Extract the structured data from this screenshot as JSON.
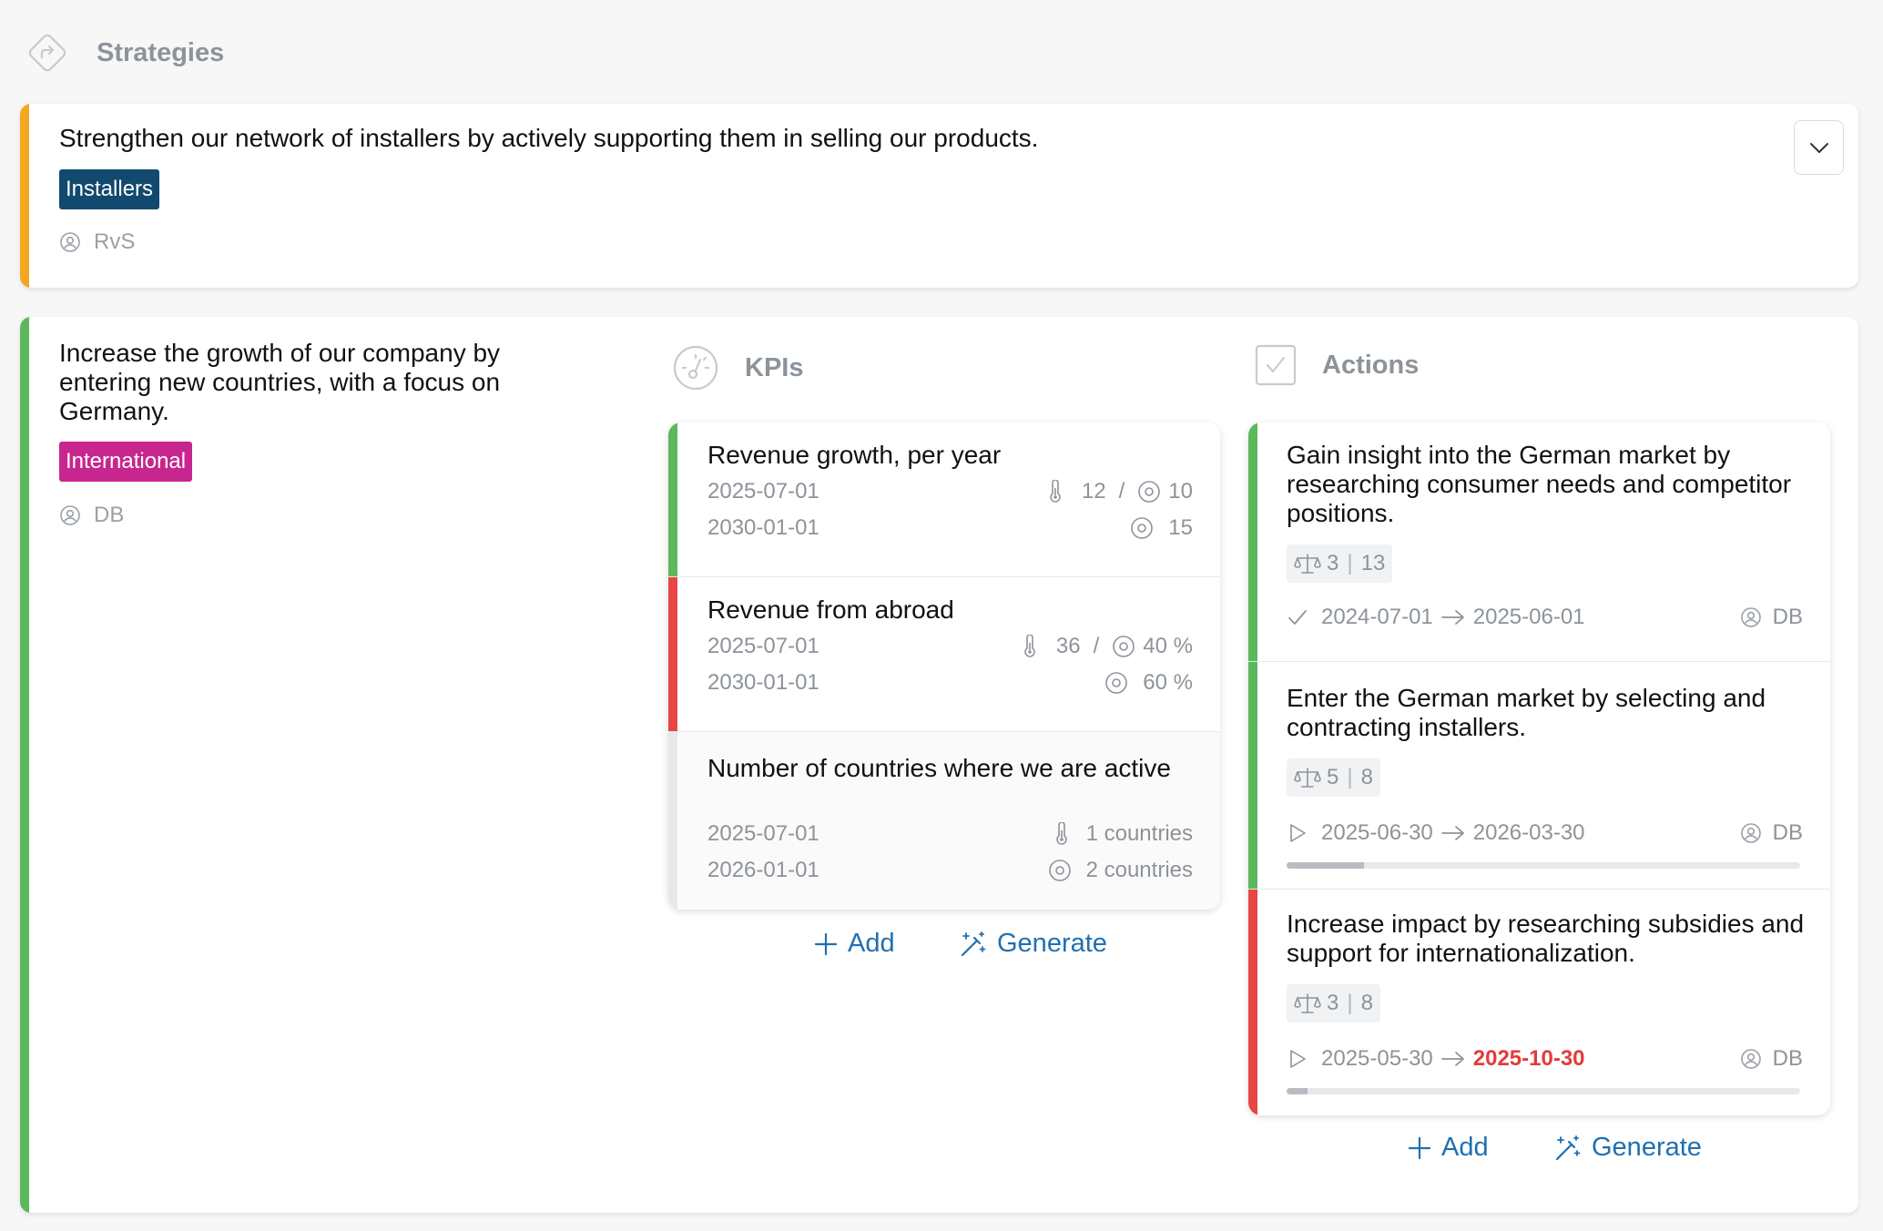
{
  "header": {
    "title": "Strategies"
  },
  "strategies": [
    {
      "text": "Strengthen our network of installers by actively supporting them in selling our products.",
      "tag": "Installers",
      "tag_color": "#12496e",
      "owner": "RvS",
      "accent": "#f5a623"
    },
    {
      "text": "Increase the growth of our company by entering new countries, with a focus on Germany.",
      "tag": "International",
      "tag_color": "#c8268f",
      "owner": "DB",
      "accent": "#5cb85c"
    }
  ],
  "kpis": {
    "heading": "KPIs",
    "items": [
      {
        "title": "Revenue growth, per year",
        "start": "2025-07-01",
        "end": "2030-01-01",
        "current": "12",
        "target_now": "10",
        "target_end": "15",
        "status": "#5cb85c"
      },
      {
        "title": "Revenue from abroad",
        "start": "2025-07-01",
        "end": "2030-01-01",
        "current": "36",
        "target_now": "40 %",
        "target_end": "60 %",
        "status": "#e84545"
      },
      {
        "title": "Number of countries where we are active",
        "start": "2025-07-01",
        "end": "2026-01-01",
        "current": "1 countries",
        "target_end": "2 countries",
        "status": ""
      }
    ],
    "add_label": "Add",
    "generate_label": "Generate"
  },
  "actions": {
    "heading": "Actions",
    "items": [
      {
        "title": "Gain insight into the German market by researching consumer needs and competitor positions.",
        "score": "3",
        "effort": "13",
        "start": "2024-07-01",
        "end": "2025-06-01",
        "owner": "DB",
        "status": "#5cb85c",
        "state": "done"
      },
      {
        "title": "Enter the German market by selecting and contracting installers.",
        "score": "5",
        "effort": "8",
        "start": "2025-06-30",
        "end": "2026-03-30",
        "owner": "DB",
        "status": "#5cb85c",
        "state": "running",
        "progress": 0.15
      },
      {
        "title": "Increase impact by researching subsidies and support for internationalization.",
        "score": "3",
        "effort": "8",
        "start": "2025-05-30",
        "end": "2025-10-30",
        "owner": "DB",
        "status": "#e84545",
        "state": "running",
        "progress": 0.04,
        "end_overdue": true
      }
    ],
    "add_label": "Add",
    "generate_label": "Generate"
  }
}
